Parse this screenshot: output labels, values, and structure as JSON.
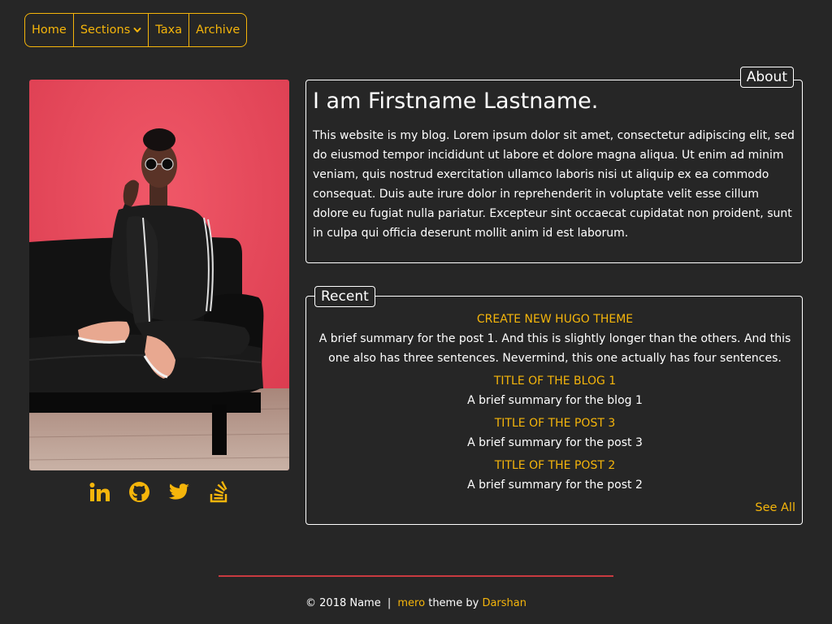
{
  "nav": {
    "items": [
      {
        "label": "Home"
      },
      {
        "label": "Sections"
      },
      {
        "label": "Taxa"
      },
      {
        "label": "Archive"
      }
    ]
  },
  "social": {
    "icons": [
      "linkedin-icon",
      "github-icon",
      "twitter-icon",
      "stackoverflow-icon"
    ],
    "color": "#f5b50b"
  },
  "about": {
    "legend": "About",
    "heading": "I am Firstname Lastname.",
    "text": "This website is my blog. Lorem ipsum dolor sit amet, consectetur adipiscing elit, sed do eiusmod tempor incididunt ut labore et dolore magna aliqua. Ut enim ad minim veniam, quis nostrud exercitation ullamco laboris nisi ut aliquip ex ea commodo consequat. Duis aute irure dolor in reprehenderit in voluptate velit esse cillum dolore eu fugiat nulla pariatur. Excepteur sint occaecat cupidatat non proident, sunt in culpa qui officia deserunt mollit anim id est laborum."
  },
  "recent": {
    "legend": "Recent",
    "posts": [
      {
        "title": "CREATE NEW HUGO THEME",
        "summary": "A brief summary for the post 1. And this is slightly longer than the others. And this one also has three sentences. Nevermind, this one actually has four sentences."
      },
      {
        "title": "TITLE OF THE BLOG 1",
        "summary": "A brief summary for the blog 1"
      },
      {
        "title": "TITLE OF THE POST 3",
        "summary": "A brief summary for the post 3"
      },
      {
        "title": "TITLE OF THE POST 2",
        "summary": "A brief summary for the post 2"
      }
    ],
    "see_all": "See All"
  },
  "footer": {
    "copyright": "© 2018 Name",
    "separator": "|",
    "theme_name": "mero",
    "theme_by": "theme by",
    "author": "Darshan"
  },
  "colors": {
    "background": "#262626",
    "accent": "#f5b50b",
    "rule": "#c93a40"
  }
}
